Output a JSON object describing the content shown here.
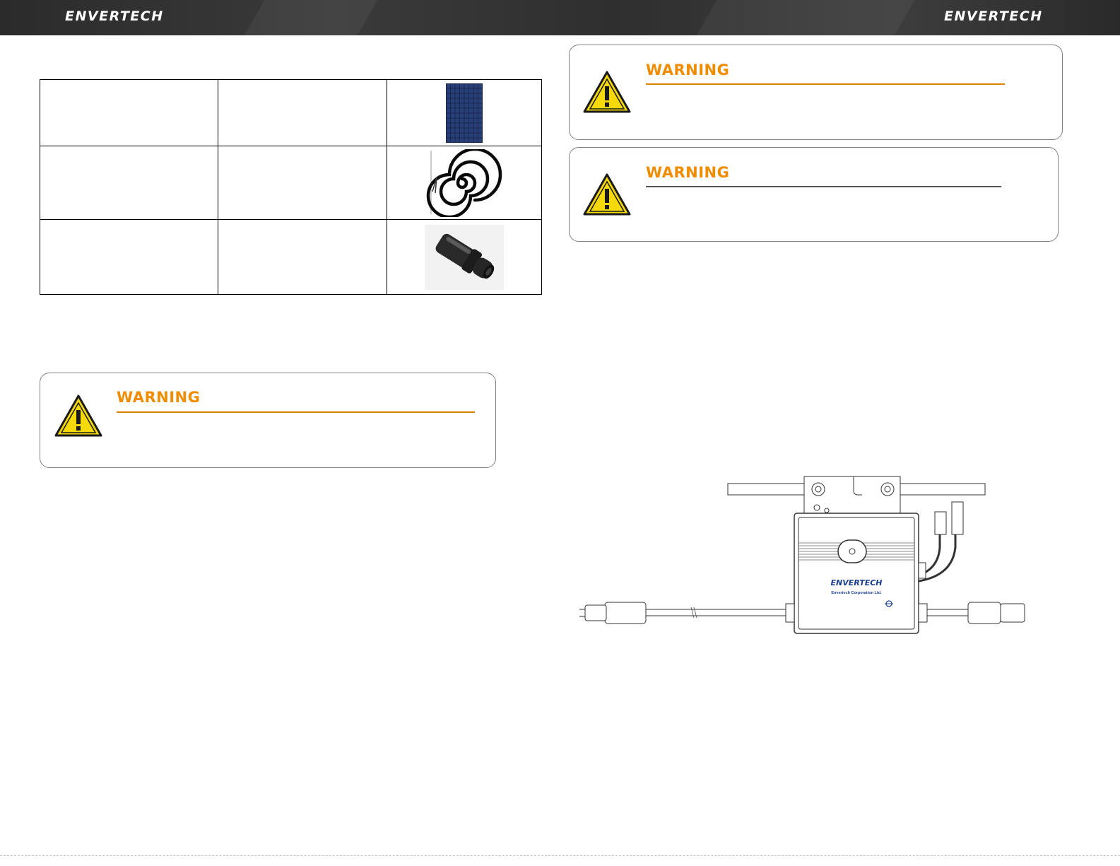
{
  "header": {
    "brand_left": "ENVERTECH",
    "brand_right": "ENVERTECH",
    "background_color": "#333333"
  },
  "components_table": {
    "rows": [
      {
        "col1": "",
        "col2": "",
        "image": "solar-panel-image"
      },
      {
        "col1": "",
        "col2": "",
        "image": "coiled-cable-image"
      },
      {
        "col1": "",
        "col2": "",
        "image": "connector-image"
      }
    ]
  },
  "warnings": [
    {
      "title": "WARNING",
      "body": "",
      "icon": "warning-triangle-icon",
      "title_color": "#ef8c00"
    },
    {
      "title": "WARNING",
      "body": "",
      "icon": "warning-triangle-icon",
      "title_color": "#ef8c00"
    },
    {
      "title": "WARNING",
      "body": "",
      "icon": "warning-triangle-icon",
      "title_color": "#ef8c00"
    }
  ],
  "microinverter": {
    "brand": "ENVERTECH",
    "company": "Envertech Corporation Ltd."
  }
}
